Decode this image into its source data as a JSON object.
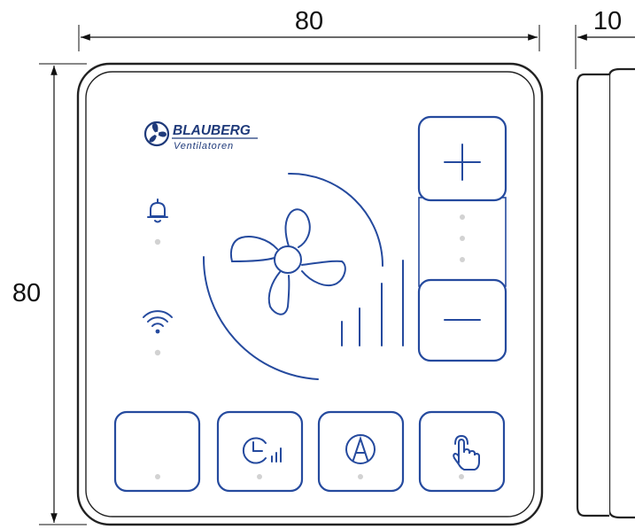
{
  "dimensions": {
    "width_label": "80",
    "height_label": "80",
    "depth_label": "10"
  },
  "logo": {
    "brand": "BLAUBERG",
    "sub": "Ventilatoren"
  },
  "colors": {
    "accent": "#254a9e",
    "panel_border": "#222222",
    "indicator": "#d2d2d2"
  },
  "indicators": {
    "alarm_icon": "bell-icon",
    "wifi_icon": "wifi-icon"
  },
  "speed_control": {
    "plus_icon": "plus-icon",
    "minus_icon": "minus-icon",
    "center_icon": "fan-speed-icon"
  },
  "bottom_buttons": [
    {
      "name": "blank-button",
      "icon": "none"
    },
    {
      "name": "timer-button",
      "icon": "clock-bars-icon"
    },
    {
      "name": "auto-mode-button",
      "icon": "auto-a-icon"
    },
    {
      "name": "touch-button",
      "icon": "hand-pointer-icon"
    }
  ]
}
